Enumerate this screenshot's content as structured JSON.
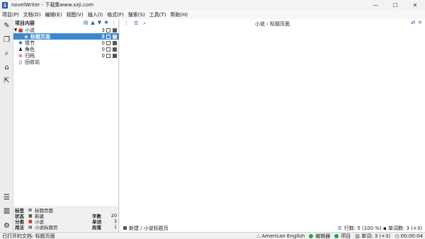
{
  "window": {
    "title": "novelWriter - 下载集www.xzji.com",
    "controls": [
      "—",
      "☐",
      "✕"
    ]
  },
  "menu": [
    "项目(P)",
    "文档(D)",
    "编辑(E)",
    "视图(V)",
    "插入(I)",
    "格式(F)",
    "搜索(S)",
    "工具(T)",
    "帮助(H)"
  ],
  "tree": {
    "header": "项目内容",
    "tools": [
      "▤",
      "▲",
      "▼",
      "✚",
      "⋮"
    ],
    "items": [
      {
        "label": "小说",
        "count": "3",
        "expand": "▼",
        "icon": "■"
      },
      {
        "label": "标题页面",
        "count": "3",
        "expand": "",
        "icon": "◈"
      },
      {
        "label": "情节",
        "count": "0",
        "expand": "",
        "icon": "✱"
      },
      {
        "label": "角色",
        "count": "0",
        "expand": "",
        "icon": "♟"
      },
      {
        "label": "归档",
        "count": "0",
        "expand": "",
        "icon": "⊗"
      },
      {
        "label": "回收站",
        "count": "0",
        "expand": "",
        "icon": "▯"
      }
    ]
  },
  "details": {
    "rows": [
      {
        "key": "标签",
        "icon": "⊠",
        "value": "标题页面",
        "key2": "",
        "value2": ""
      },
      {
        "key": "状态",
        "icon": "■",
        "value": "新建",
        "key2": "字数",
        "value2": "20"
      },
      {
        "key": "分类",
        "icon": "■",
        "value": "小说",
        "key2": "单词",
        "value2": "3"
      },
      {
        "key": "用法",
        "icon": "▤",
        "value": "小说标题页",
        "key2": "段落",
        "value2": "1"
      }
    ]
  },
  "editor": {
    "path": "小说 › 标题页面",
    "tools": [
      "⋮",
      "☰",
      "⌕"
    ],
    "right_tools": [
      "⇄",
      "✕"
    ],
    "footer_left": "新建 / 小说标题页",
    "footer_right": "行数: 5 (100 %)  ▪  单词数: 3 (+3)"
  },
  "statusbar": {
    "left": "已打开的文档: 标题页面",
    "language": "American English",
    "editor": "编辑器",
    "project": "项目",
    "words": "单词: 3 (+3)",
    "time": "00:00:04"
  },
  "colors": {
    "accent": "#3d87cf",
    "status_green": "#1fa34a",
    "novel_red": "#c0392b"
  }
}
